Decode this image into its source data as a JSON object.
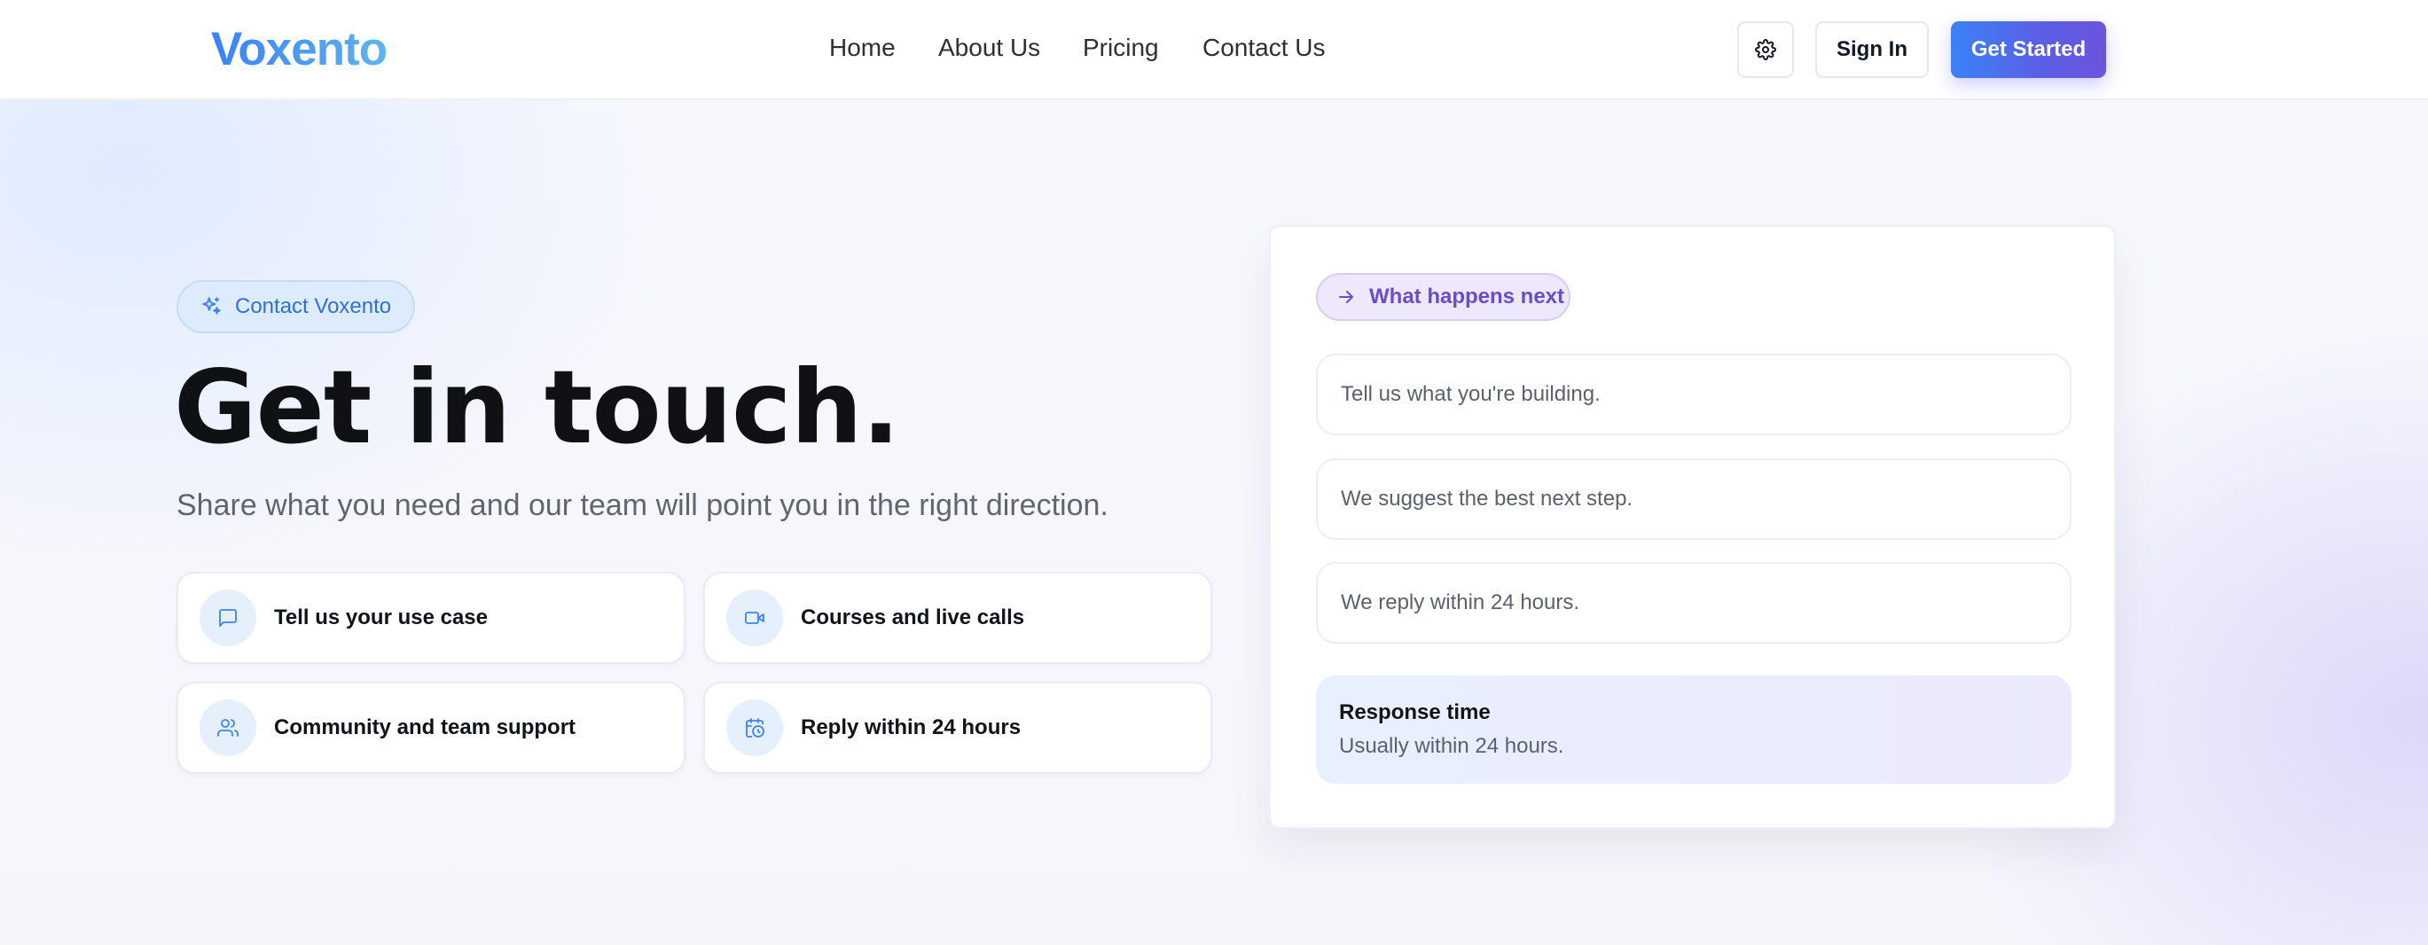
{
  "brand": {
    "name": "Voxento"
  },
  "nav": {
    "items": [
      {
        "label": "Home"
      },
      {
        "label": "About Us"
      },
      {
        "label": "Pricing"
      },
      {
        "label": "Contact Us"
      }
    ]
  },
  "header_actions": {
    "settings_icon": "gear-icon",
    "sign_in_label": "Sign In",
    "get_started_label": "Get Started"
  },
  "hero": {
    "badge": "Contact Voxento",
    "badge_icon": "sparkle-icon",
    "title": "Get in touch.",
    "subtitle": "Share what you need and our team will point you in the right direction.",
    "features": [
      {
        "label": "Tell us your use case",
        "icon": "chat-bubble-icon"
      },
      {
        "label": "Courses and live calls",
        "icon": "video-camera-icon"
      },
      {
        "label": "Community and team support",
        "icon": "users-icon"
      },
      {
        "label": "Reply within 24 hours",
        "icon": "calendar-clock-icon"
      }
    ]
  },
  "next_card": {
    "badge": "What happens next",
    "badge_icon": "arrow-right-icon",
    "steps": [
      {
        "text": "Tell us what you're building."
      },
      {
        "text": "We suggest the best next step."
      },
      {
        "text": "We reply within 24 hours."
      }
    ],
    "response": {
      "title": "Response time",
      "value": "Usually within 24 hours."
    }
  },
  "colors": {
    "accent_blue": "#3b82f6",
    "accent_purple": "#6d54dc",
    "text_dark": "#111318",
    "text_muted": "#5b616b"
  }
}
